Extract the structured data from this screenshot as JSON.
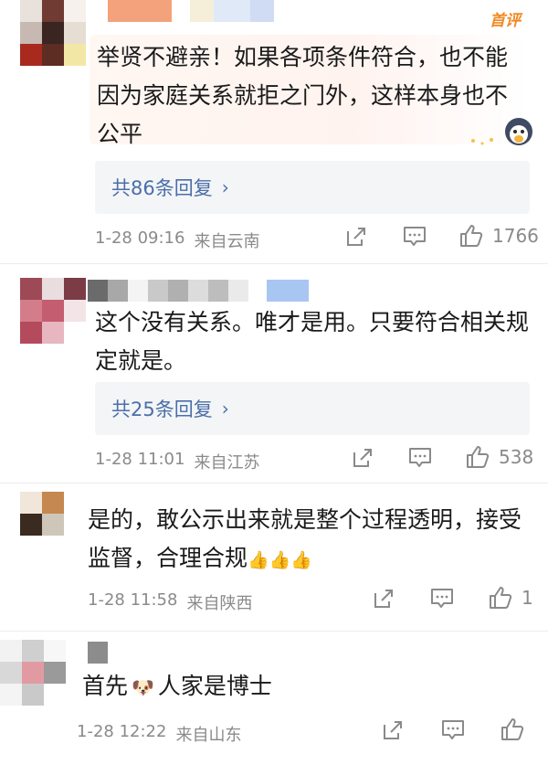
{
  "badge": {
    "hot": "首评"
  },
  "comments": [
    {
      "text_lines": [
        "举贤不避亲！如果各项条件符合，也不能",
        "因为家庭关系就拒之门外，这样本身也不",
        "公平"
      ],
      "replies": "共86条回复",
      "time": "1-28 09:16",
      "location": "来自云南",
      "likes": "1766"
    },
    {
      "text_lines": [
        "这个没有关系。唯才是用。只要符合相关规",
        "定就是。"
      ],
      "replies": "共25条回复",
      "time": "1-28 11:01",
      "location": "来自江苏",
      "likes": "538"
    },
    {
      "text_lines": [
        "是的，敢公示出来就是整个过程透明，接受",
        "监督，合理合规"
      ],
      "emoji_tail": "👍👍👍",
      "time": "1-28 11:58",
      "location": "来自陕西",
      "likes": "1"
    },
    {
      "text_before": "首先",
      "emoji": "🐶",
      "text_after": "人家是博士",
      "time": "1-28 12:22",
      "location": "来自山东",
      "likes": ""
    }
  ],
  "icons": {
    "share": "share-icon",
    "comment": "comment-icon",
    "like": "thumbs-up-icon",
    "reply_chevron": "chevron-right-icon"
  }
}
